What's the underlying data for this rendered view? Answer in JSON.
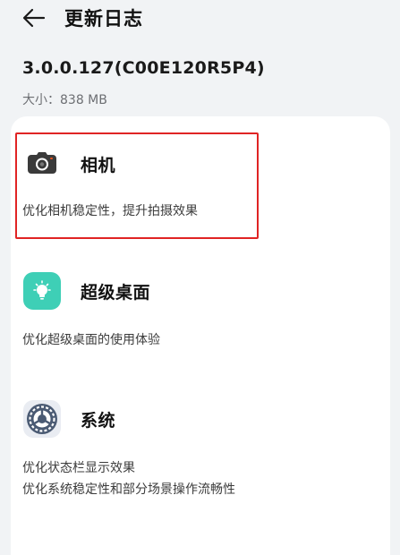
{
  "header": {
    "title": "更新日志"
  },
  "version": {
    "number": "3.0.0.127(C00E120R5P4)",
    "size": "大小：838 MB"
  },
  "updates": [
    {
      "app": "相机",
      "icon": "camera-icon",
      "lines": [
        "优化相机稳定性，提升拍摄效果"
      ]
    },
    {
      "app": "超级桌面",
      "icon": "lightbulb-icon",
      "lines": [
        "优化超级桌面的使用体验"
      ]
    },
    {
      "app": "系统",
      "icon": "settings-gear-icon",
      "lines": [
        "优化状态栏显示效果",
        "优化系统稳定性和部分场景操作流畅性"
      ]
    }
  ],
  "colors": {
    "background": "#f1f3f5",
    "card": "#ffffff",
    "highlight": "#e02424",
    "desktop_icon": "#3ecfb6",
    "system_icon": "#4a5a73"
  }
}
